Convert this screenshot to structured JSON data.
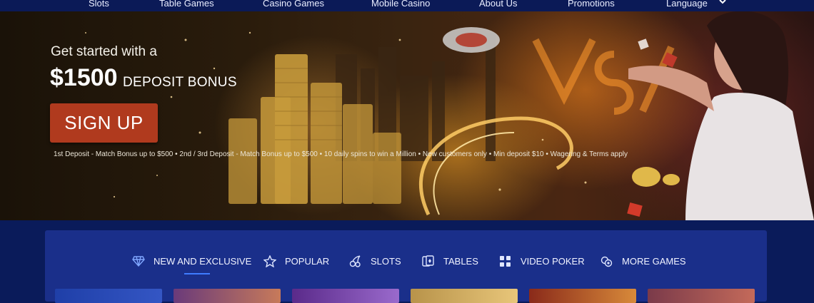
{
  "nav": {
    "items": [
      "Slots",
      "Table Games",
      "Casino Games",
      "Mobile Casino",
      "About Us",
      "Promotions",
      "Language"
    ]
  },
  "hero": {
    "line1": "Get started with a",
    "amount": "$1500",
    "bonus": "DEPOSIT BONUS",
    "signup": "SIGN UP",
    "terms": "1st Deposit - Match Bonus up to $500 • 2nd / 3rd Deposit - Match Bonus up to $500 • 10 daily spins to win a Million • New customers only • Min deposit $10 • Wagering & Terms apply"
  },
  "games": {
    "tabs": [
      "NEW AND EXCLUSIVE",
      "POPULAR",
      "SLOTS",
      "TABLES",
      "VIDEO POKER",
      "MORE GAMES"
    ],
    "active_tab": "NEW AND EXCLUSIVE",
    "tab_icons": [
      "diamond-icon",
      "star-icon",
      "cherry-icon",
      "cards-icon",
      "dice-icon",
      "chips-icon"
    ]
  },
  "colors": {
    "nav_bg": "#0b1a57",
    "panel_bg": "#1a2f8a",
    "page_bg": "#0a1b5a",
    "signup_bg": "#b03a1e",
    "tab_underline": "#3f7cff"
  }
}
